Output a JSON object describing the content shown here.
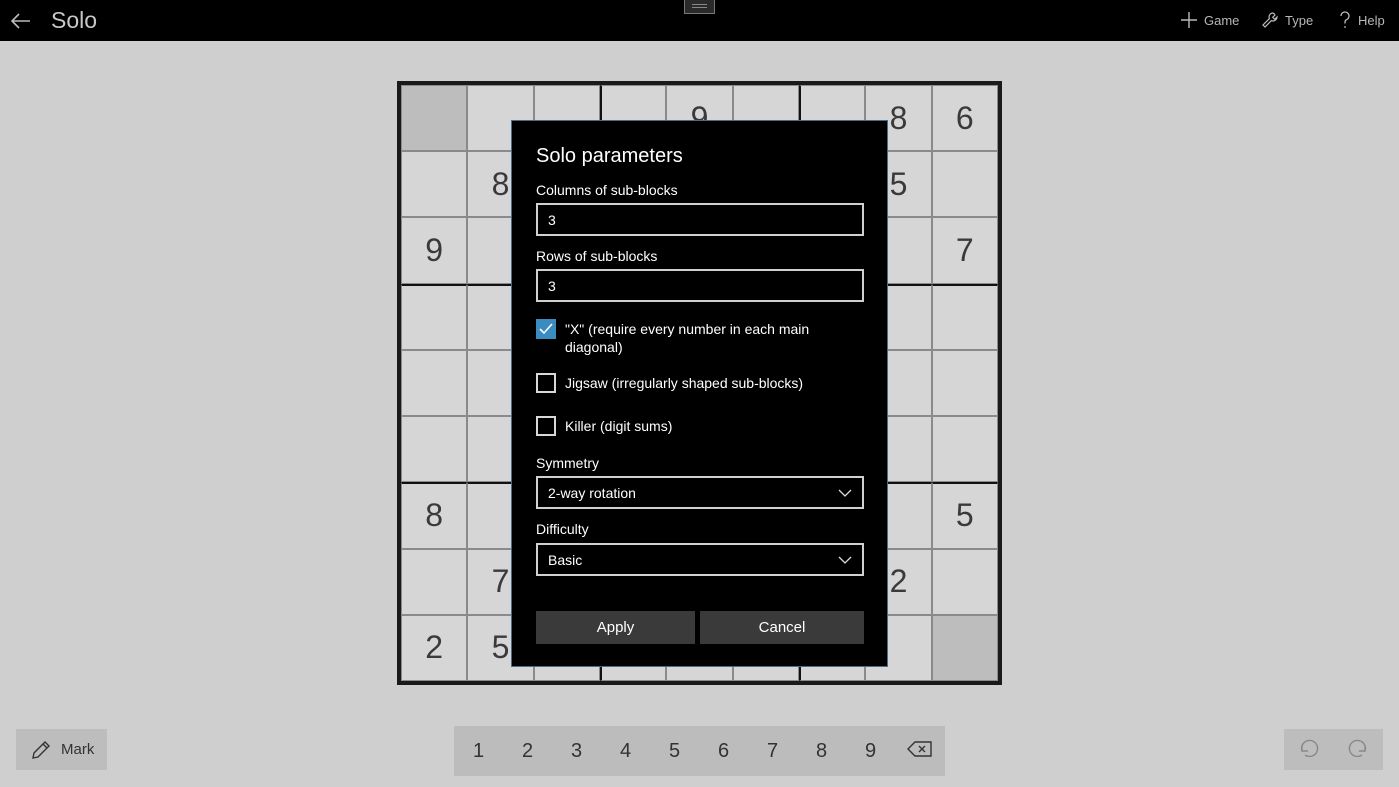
{
  "titlebar": {
    "title": "Solo",
    "game_label": "Game",
    "type_label": "Type",
    "help_label": "Help"
  },
  "board": {
    "cells": [
      "",
      "",
      "",
      "",
      "9",
      "",
      "",
      "8",
      "6",
      "",
      "8",
      "",
      "",
      "",
      "",
      "",
      "5",
      "",
      "9",
      "",
      "",
      "",
      "",
      "",
      "",
      "",
      "7",
      "",
      "",
      "",
      "",
      "",
      "",
      "",
      "",
      "",
      "",
      "",
      "",
      "",
      "",
      "",
      "",
      "",
      "",
      "",
      "",
      "",
      "",
      "",
      "",
      "",
      "",
      "",
      "8",
      "",
      "",
      "",
      "",
      "",
      "",
      "",
      "5",
      "",
      "7",
      "",
      "",
      "",
      "",
      "",
      "2",
      "",
      "2",
      "5",
      "",
      "",
      "",
      "",
      "",
      "",
      ""
    ],
    "shaded": [
      0,
      80
    ]
  },
  "bottombar": {
    "mark_label": "Mark",
    "numbers": [
      "1",
      "2",
      "3",
      "4",
      "5",
      "6",
      "7",
      "8",
      "9"
    ]
  },
  "dialog": {
    "title": "Solo parameters",
    "columns_label": "Columns of sub-blocks",
    "columns_value": "3",
    "rows_label": "Rows of sub-blocks",
    "rows_value": "3",
    "x_label": "\"X\" (require every number in each main diagonal)",
    "x_checked": true,
    "jigsaw_label": "Jigsaw (irregularly shaped sub-blocks)",
    "jigsaw_checked": false,
    "killer_label": "Killer (digit sums)",
    "killer_checked": false,
    "symmetry_label": "Symmetry",
    "symmetry_value": "2-way rotation",
    "difficulty_label": "Difficulty",
    "difficulty_value": "Basic",
    "apply_label": "Apply",
    "cancel_label": "Cancel"
  },
  "colors": {
    "titlebar_bg": "#000000",
    "dialog_bg": "#000000",
    "checkbox_accent": "#3a8bc0",
    "button_bg": "#3a3a3a"
  }
}
